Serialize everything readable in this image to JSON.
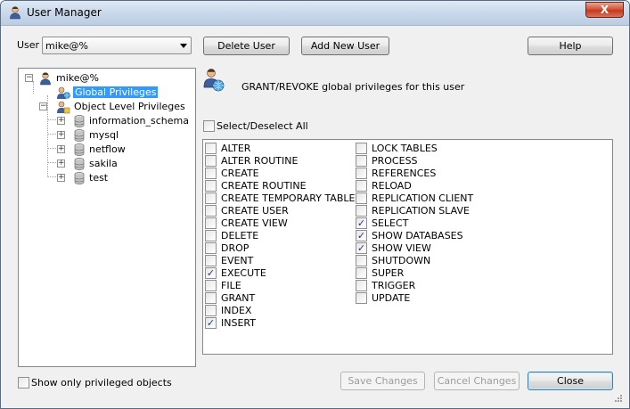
{
  "window": {
    "title": "User Manager",
    "close_glyph": "X"
  },
  "user_label": "User",
  "user_combo": {
    "value": "mike@%"
  },
  "toolbar": {
    "delete_user": "Delete User",
    "add_new_user": "Add New User",
    "help": "Help"
  },
  "tree": {
    "root": "mike@%",
    "global": "Global Privileges",
    "object_level": "Object Level Privileges",
    "schemas": [
      "information_schema",
      "mysql",
      "netflow",
      "sakila",
      "test"
    ]
  },
  "header_text": "GRANT/REVOKE global privileges for this user",
  "select_all": {
    "label": "Select/Deselect All",
    "checked": false
  },
  "privileges_col1": [
    {
      "label": "ALTER",
      "checked": false
    },
    {
      "label": "ALTER ROUTINE",
      "checked": false
    },
    {
      "label": "CREATE",
      "checked": false
    },
    {
      "label": "CREATE ROUTINE",
      "checked": false
    },
    {
      "label": "CREATE TEMPORARY TABLES",
      "checked": false
    },
    {
      "label": "CREATE USER",
      "checked": false
    },
    {
      "label": "CREATE VIEW",
      "checked": false
    },
    {
      "label": "DELETE",
      "checked": false
    },
    {
      "label": "DROP",
      "checked": false
    },
    {
      "label": "EVENT",
      "checked": false
    },
    {
      "label": "EXECUTE",
      "checked": true
    },
    {
      "label": "FILE",
      "checked": false
    },
    {
      "label": "GRANT",
      "checked": false
    },
    {
      "label": "INDEX",
      "checked": false
    },
    {
      "label": "INSERT",
      "checked": true
    }
  ],
  "privileges_col2": [
    {
      "label": "LOCK TABLES",
      "checked": false
    },
    {
      "label": "PROCESS",
      "checked": false
    },
    {
      "label": "REFERENCES",
      "checked": false
    },
    {
      "label": "RELOAD",
      "checked": false
    },
    {
      "label": "REPLICATION CLIENT",
      "checked": false
    },
    {
      "label": "REPLICATION SLAVE",
      "checked": false
    },
    {
      "label": "SELECT",
      "checked": true
    },
    {
      "label": "SHOW DATABASES",
      "checked": true
    },
    {
      "label": "SHOW VIEW",
      "checked": true
    },
    {
      "label": "SHUTDOWN",
      "checked": false
    },
    {
      "label": "SUPER",
      "checked": false
    },
    {
      "label": "TRIGGER",
      "checked": false
    },
    {
      "label": "UPDATE",
      "checked": false
    }
  ],
  "footer": {
    "show_only_privileged": {
      "label": "Show only privileged objects",
      "checked": false
    },
    "save_changes": "Save Changes",
    "cancel_changes": "Cancel Changes",
    "close": "Close"
  }
}
